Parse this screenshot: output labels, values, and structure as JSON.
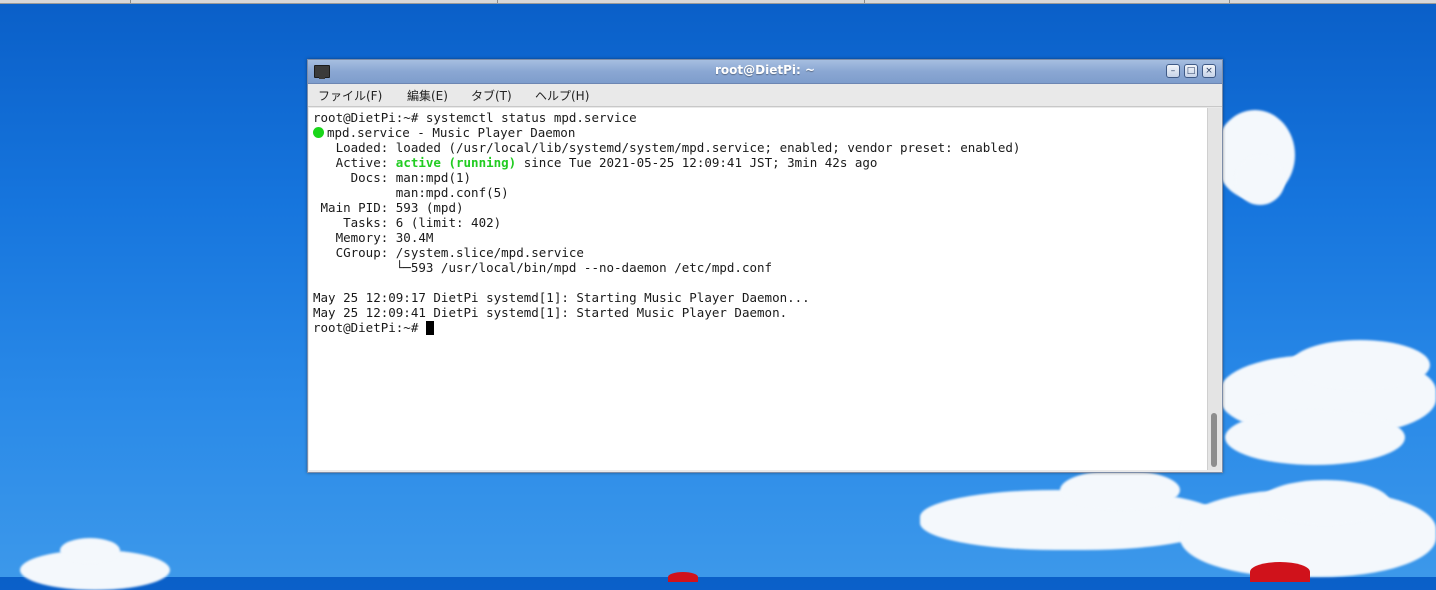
{
  "window": {
    "title": "root@DietPi: ~",
    "controls": {
      "minimize": "–",
      "maximize": "□",
      "close": "×"
    }
  },
  "menu": [
    "ファイル(F)",
    "編集(E)",
    "タブ(T)",
    "ヘルプ(H)"
  ],
  "terminal": {
    "command_line": "root@DietPi:~# systemctl status mpd.service",
    "service_header": "mpd.service - Music Player Daemon",
    "loaded": "   Loaded: loaded (/usr/local/lib/systemd/system/mpd.service; enabled; vendor preset: enabled)",
    "active_label": "   Active: ",
    "active_state": "active (running)",
    "active_rest": " since Tue 2021-05-25 12:09:41 JST; 3min 42s ago",
    "docs1": "     Docs: man:mpd(1)",
    "docs2": "           man:mpd.conf(5)",
    "main_pid": " Main PID: 593 (mpd)",
    "tasks": "    Tasks: 6 (limit: 402)",
    "memory": "   Memory: 30.4M",
    "cgroup": "   CGroup: /system.slice/mpd.service",
    "cgroup_child": "           └─593 /usr/local/bin/mpd --no-daemon /etc/mpd.conf",
    "log1": "May 25 12:09:17 DietPi systemd[1]: Starting Music Player Daemon...",
    "log2": "May 25 12:09:41 DietPi systemd[1]: Started Music Player Daemon.",
    "prompt": "root@DietPi:~# "
  },
  "colors": {
    "status_active": "#22cc22",
    "titlebar": "#8aa7d3",
    "desktop": "#1675dd"
  }
}
